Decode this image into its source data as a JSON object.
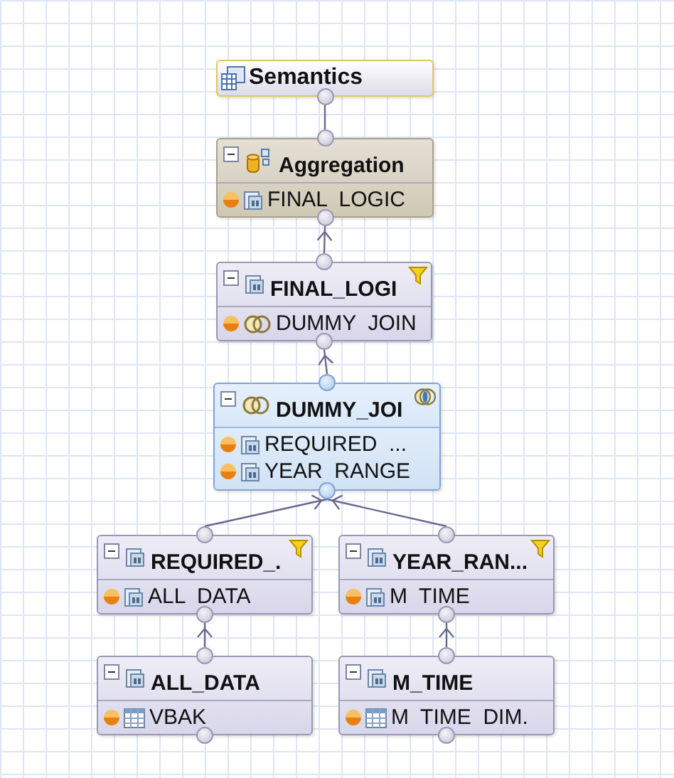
{
  "diagram": {
    "nodes": [
      {
        "kind": "semantics",
        "title": "Semantics",
        "selected": false,
        "filtered": false
      },
      {
        "kind": "aggregation",
        "title": "Aggregation",
        "selected": false,
        "filtered": false,
        "inputs": [
          {
            "label": "FINAL  LOGIC",
            "kind": "view"
          }
        ]
      },
      {
        "kind": "projection",
        "title": "FINAL_LOGI",
        "selected": false,
        "filtered": true,
        "inputs": [
          {
            "label": "DUMMY  JOIN",
            "kind": "join"
          }
        ]
      },
      {
        "kind": "join",
        "title": "DUMMY_JOI",
        "selected": true,
        "filtered": false,
        "inputs": [
          {
            "label": "REQUIRED  ...",
            "kind": "view"
          },
          {
            "label": "YEAR  RANGE",
            "kind": "view"
          }
        ]
      },
      {
        "kind": "projection",
        "title": "REQUIRED_.",
        "selected": false,
        "filtered": true,
        "inputs": [
          {
            "label": "ALL  DATA",
            "kind": "view"
          }
        ]
      },
      {
        "kind": "projection",
        "title": "YEAR_RAN...",
        "selected": false,
        "filtered": true,
        "inputs": [
          {
            "label": "M  TIME",
            "kind": "view"
          }
        ]
      },
      {
        "kind": "projection",
        "title": "ALL_DATA",
        "selected": false,
        "filtered": false,
        "inputs": [
          {
            "label": "VBAK",
            "kind": "table"
          }
        ]
      },
      {
        "kind": "projection",
        "title": "M_TIME",
        "selected": false,
        "filtered": false,
        "inputs": [
          {
            "label": "M  TIME  DIM.",
            "kind": "table"
          }
        ]
      }
    ]
  }
}
